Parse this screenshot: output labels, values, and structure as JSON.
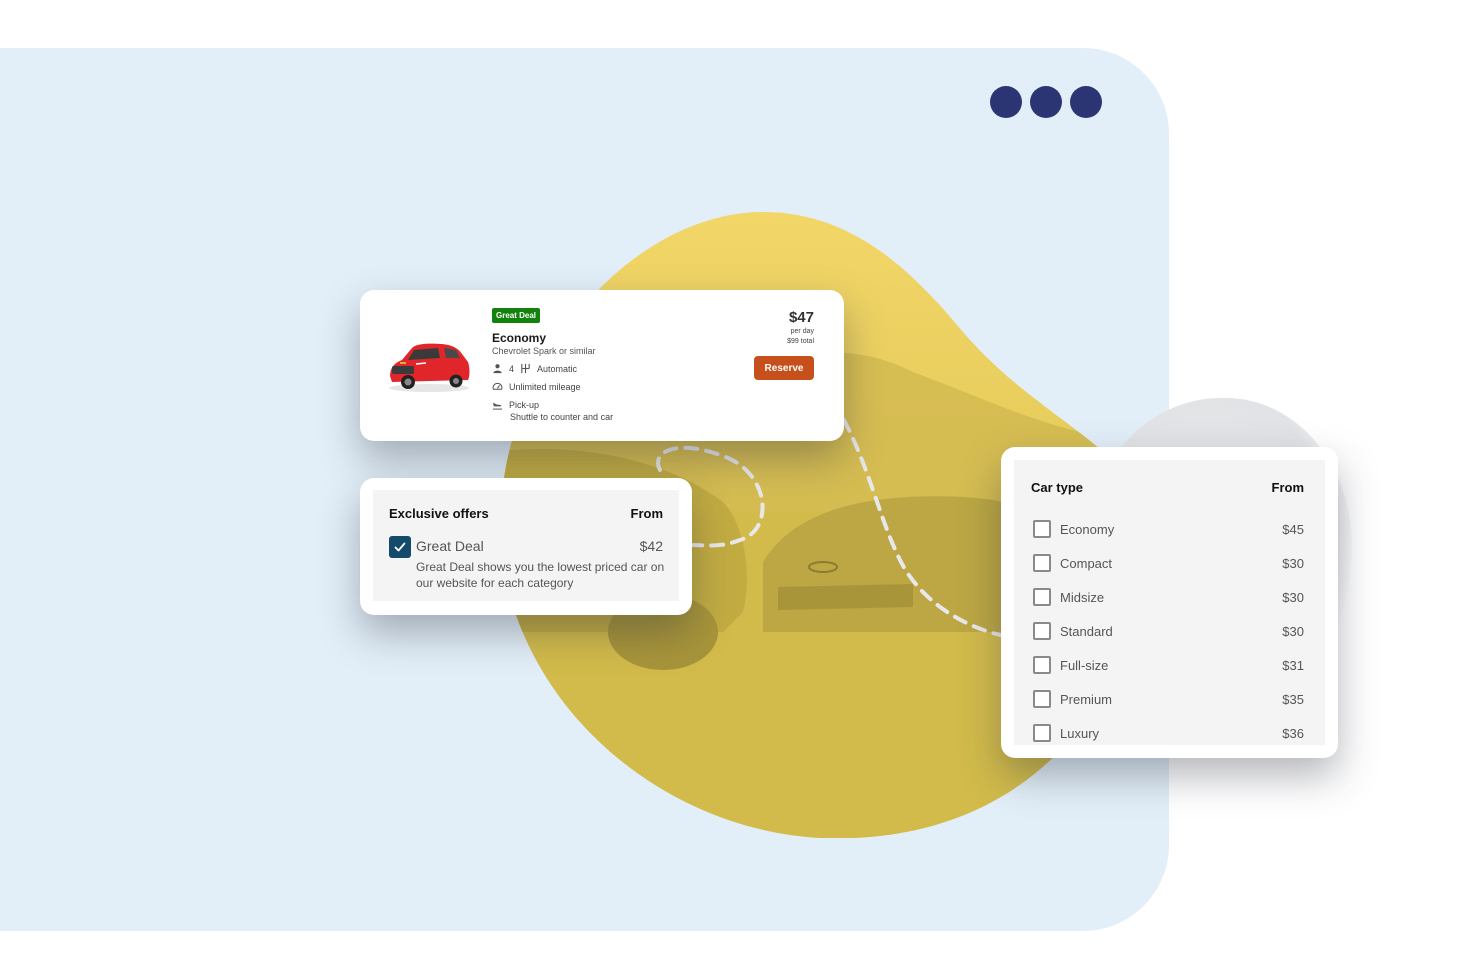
{
  "colors": {
    "panel_bg": "#e2eef8",
    "dots": "#2c3574",
    "blob_yellow": "#d9c24a",
    "badge_green": "#13820d",
    "reserve_orange": "#c64f1b",
    "checkbox_checked": "#154b6a"
  },
  "window_controls": {
    "icon": "three-dots-icon",
    "count": 3
  },
  "listing": {
    "badge": "Great Deal",
    "title": "Economy",
    "subtitle": "Chevrolet Spark or similar",
    "image": "red-hatchback-car",
    "passengers": "4",
    "transmission": "Automatic",
    "mileage": "Unlimited mileage",
    "pickup_label": "Pick-up",
    "pickup_detail": "Shuttle to counter and car",
    "price": "$47",
    "price_unit": "per day",
    "total": "$99 total",
    "reserve_label": "Reserve",
    "icons": [
      "person-icon",
      "gearshift-icon",
      "speedometer-icon",
      "plane-landing-icon"
    ]
  },
  "exclusive_offers": {
    "title": "Exclusive offers",
    "from_label": "From",
    "item": {
      "label": "Great Deal",
      "price": "$42",
      "checked": true,
      "description": "Great Deal shows you the lowest priced car on our website for each category"
    }
  },
  "car_type": {
    "title": "Car type",
    "from_label": "From",
    "items": [
      {
        "label": "Economy",
        "price": "$45",
        "checked": false
      },
      {
        "label": "Compact",
        "price": "$30",
        "checked": false
      },
      {
        "label": "Midsize",
        "price": "$30",
        "checked": false
      },
      {
        "label": "Standard",
        "price": "$30",
        "checked": false
      },
      {
        "label": "Full-size",
        "price": "$31",
        "checked": false
      },
      {
        "label": "Premium",
        "price": "$35",
        "checked": false
      },
      {
        "label": "Luxury",
        "price": "$36",
        "checked": false
      }
    ]
  }
}
